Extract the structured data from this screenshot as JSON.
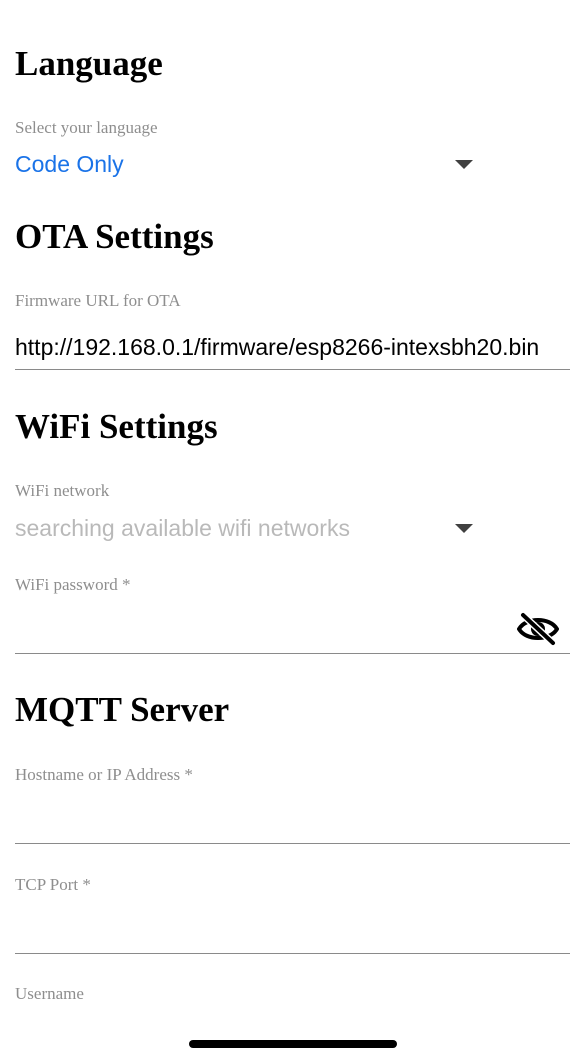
{
  "language_section": {
    "heading": "Language",
    "select_label": "Select your language",
    "selected_value": "Code Only",
    "caret_icon": "caret-down-icon",
    "accent_color": "#1a73e8"
  },
  "ota_section": {
    "heading": "OTA Settings",
    "firmware_url_label": "Firmware URL for OTA",
    "firmware_url_value": "http://192.168.0.1/firmware/esp8266-intexsbh20.bin"
  },
  "wifi_section": {
    "heading": "WiFi Settings",
    "network_label": "WiFi network",
    "network_value": "searching available wifi networks",
    "caret_icon": "caret-down-icon",
    "password_label": "WiFi password *",
    "password_value": "",
    "visibility_icon": "eye-off-icon"
  },
  "mqtt_section": {
    "heading": "MQTT Server",
    "hostname_label": "Hostname or IP Address *",
    "hostname_value": "",
    "port_label": "TCP Port *",
    "port_value": "",
    "username_label": "Username"
  }
}
